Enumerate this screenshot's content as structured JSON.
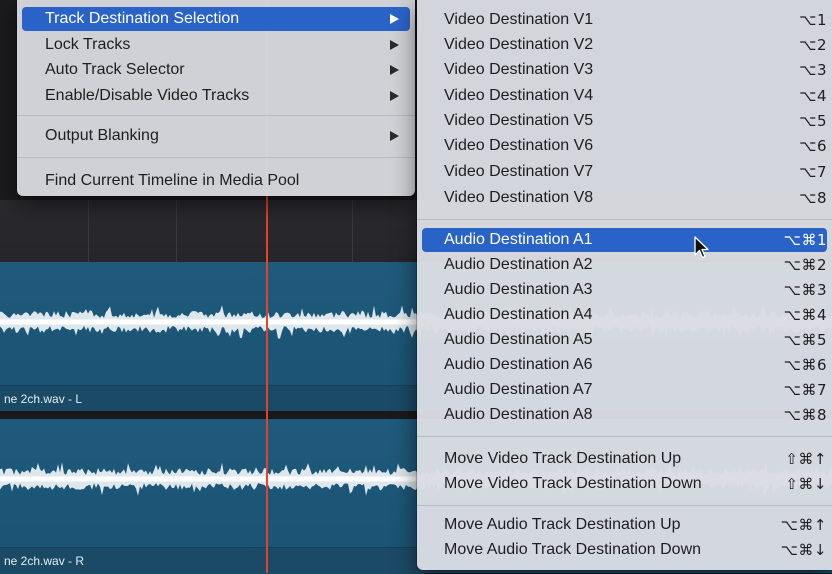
{
  "timeline": {
    "clips": {
      "left_label": "ne 2ch.wav - L",
      "right_label": "ne 2ch.wav - R"
    },
    "colors": {
      "track": "#1f5a7c",
      "playhead": "#e4412e"
    }
  },
  "main_menu": {
    "items": [
      {
        "label": "Track Destination Selection",
        "submenu": true,
        "selected": true
      },
      {
        "label": "Lock Tracks",
        "submenu": true
      },
      {
        "label": "Auto Track Selector",
        "submenu": true
      },
      {
        "label": "Enable/Disable Video Tracks",
        "submenu": true
      },
      {
        "label": "Output Blanking",
        "submenu": true
      },
      {
        "label": "Find Current Timeline in Media Pool",
        "submenu": false
      }
    ]
  },
  "submenu": {
    "video_items": [
      {
        "label": "Video Destination V1",
        "shortcut": "⌥1"
      },
      {
        "label": "Video Destination V2",
        "shortcut": "⌥2"
      },
      {
        "label": "Video Destination V3",
        "shortcut": "⌥3"
      },
      {
        "label": "Video Destination V4",
        "shortcut": "⌥4"
      },
      {
        "label": "Video Destination V5",
        "shortcut": "⌥5"
      },
      {
        "label": "Video Destination V6",
        "shortcut": "⌥6"
      },
      {
        "label": "Video Destination V7",
        "shortcut": "⌥7"
      },
      {
        "label": "Video Destination V8",
        "shortcut": "⌥8"
      }
    ],
    "audio_items": [
      {
        "label": "Audio Destination A1",
        "shortcut": "⌥⌘1",
        "selected": true
      },
      {
        "label": "Audio Destination A2",
        "shortcut": "⌥⌘2"
      },
      {
        "label": "Audio Destination A3",
        "shortcut": "⌥⌘3"
      },
      {
        "label": "Audio Destination A4",
        "shortcut": "⌥⌘4"
      },
      {
        "label": "Audio Destination A5",
        "shortcut": "⌥⌘5"
      },
      {
        "label": "Audio Destination A6",
        "shortcut": "⌥⌘6"
      },
      {
        "label": "Audio Destination A7",
        "shortcut": "⌥⌘7"
      },
      {
        "label": "Audio Destination A8",
        "shortcut": "⌥⌘8"
      }
    ],
    "video_move_items": [
      {
        "label": "Move Video Track Destination Up",
        "shortcut": "⇧⌘↑"
      },
      {
        "label": "Move Video Track Destination Down",
        "shortcut": "⇧⌘↓"
      }
    ],
    "audio_move_items": [
      {
        "label": "Move Audio Track Destination Up",
        "shortcut": "⌥⌘↑"
      },
      {
        "label": "Move Audio Track Destination Down",
        "shortcut": "⌥⌘↓"
      }
    ]
  },
  "selection_color": "#2a63c8"
}
